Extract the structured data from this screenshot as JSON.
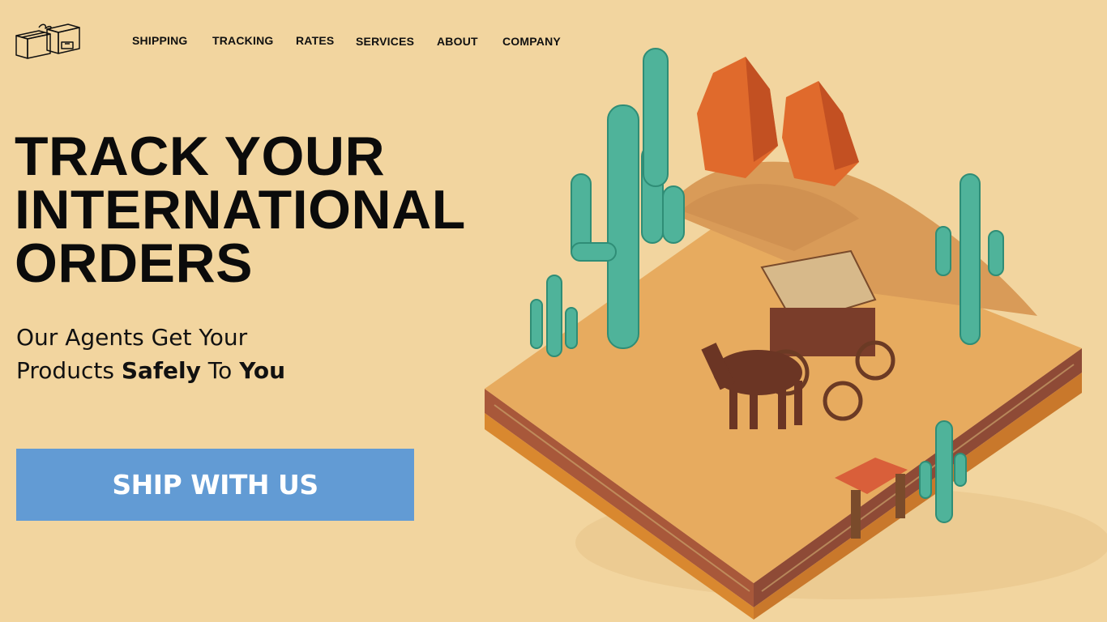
{
  "brand": {
    "logo_icon": "package-boxes-icon"
  },
  "nav": {
    "items": [
      {
        "label": "SHIPPING"
      },
      {
        "label": "TRACKING"
      },
      {
        "label": "RATES"
      },
      {
        "label": "SERVICES"
      },
      {
        "label": "ABOUT"
      },
      {
        "label": "COMPANY"
      }
    ]
  },
  "hero": {
    "title_lines": [
      "TRACK YOUR",
      "INTERNATIONAL",
      "ORDERS"
    ],
    "subtitle": {
      "line1": "Our Agents Get Your",
      "line2_start": "Products ",
      "line2_bold1": "Safely",
      "line2_mid": " To ",
      "line2_bold2": "You"
    },
    "cta_label": "SHIP WITH US"
  },
  "colors": {
    "background": "#f2d59f",
    "cta": "#629bd4",
    "text": "#0b0b0b",
    "cactus": "#4fb39a",
    "rock": "#e06a2c",
    "sand": "#e7ab5f"
  }
}
